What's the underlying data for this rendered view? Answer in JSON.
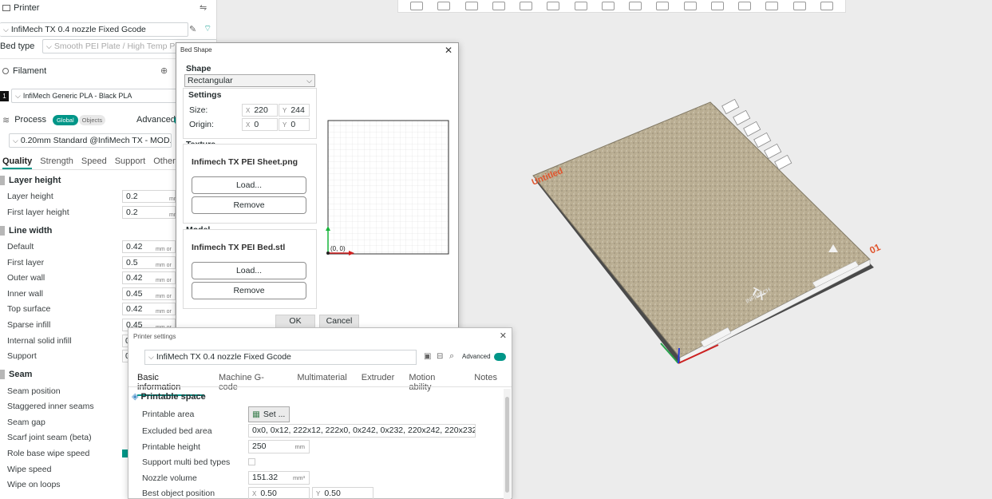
{
  "left": {
    "printer_header": "Printer",
    "printer_name": "InfiMech TX 0.4 nozzle Fixed Gcode",
    "bed_type_label": "Bed type",
    "bed_type_value": "Smooth PEI Plate / High Temp Pla",
    "filament_header": "Filament",
    "filament_index": "1",
    "filament_value": "InfiMech Generic PLA - Black PLA",
    "process_header": "Process",
    "global_badge": "Global",
    "objects_badge": "Objects",
    "advanced_label": "Advanced",
    "process_value": "0.20mm Standard @InfiMech TX - MOD...",
    "tabs": [
      "Quality",
      "Strength",
      "Speed",
      "Support",
      "Others"
    ],
    "groups": {
      "layer_height": "Layer height",
      "line_width": "Line width",
      "seam": "Seam"
    },
    "rows": [
      {
        "label": "Layer height",
        "value": "0.2",
        "unit": "mm"
      },
      {
        "label": "First layer height",
        "value": "0.2",
        "unit": "mm"
      },
      {
        "label": "Default",
        "value": "0.42",
        "unit": "mm or %"
      },
      {
        "label": "First layer",
        "value": "0.5",
        "unit": "mm or %"
      },
      {
        "label": "Outer wall",
        "value": "0.42",
        "unit": "mm or %"
      },
      {
        "label": "Inner wall",
        "value": "0.45",
        "unit": "mm or %"
      },
      {
        "label": "Top surface",
        "value": "0.42",
        "unit": "mm or %"
      },
      {
        "label": "Sparse infill",
        "value": "0.45",
        "unit": "mm or %"
      },
      {
        "label": "Internal solid infill",
        "value": "0",
        "unit": ""
      },
      {
        "label": "Support",
        "value": "0",
        "unit": ""
      }
    ],
    "seam_rows": [
      "Seam position",
      "Staggered inner seams",
      "Seam gap",
      "Scarf joint seam (beta)",
      "Role base wipe speed",
      "Wipe speed",
      "Wipe on loops"
    ]
  },
  "plate": {
    "name": "Untitled",
    "number": "01",
    "brand": "TX",
    "sub": "INFIMECH"
  },
  "bed_dialog": {
    "title": "Bed Shape",
    "shape_header": "Shape",
    "shape_value": "Rectangular",
    "settings_header": "Settings",
    "size_label": "Size:",
    "origin_label": "Origin:",
    "size_x": "220",
    "size_y": "244",
    "origin_x": "0",
    "origin_y": "0",
    "x_tag": "X",
    "y_tag": "Y",
    "texture_header": "Texture",
    "texture_file": "Infimech TX PEI Sheet.png",
    "model_header": "Model",
    "model_file": "Infimech TX PEI Bed.stl",
    "load_label": "Load...",
    "remove_label": "Remove",
    "origin_mark": "(0, 0)",
    "ok_label": "OK",
    "cancel_label": "Cancel"
  },
  "printer_settings": {
    "title": "Printer settings",
    "preset": "InfiMech TX 0.4 nozzle Fixed Gcode",
    "advanced_label": "Advanced",
    "tabs": [
      "Basic information",
      "Machine G-code",
      "Multimaterial",
      "Extruder",
      "Motion ability",
      "Notes"
    ],
    "section": "Printable space",
    "printable_area_label": "Printable area",
    "set_label": "Set ...",
    "excluded_label": "Excluded bed area",
    "excluded_value": "0x0, 0x12, 222x12, 222x0, 0x242, 0x232, 220x242, 220x232",
    "height_label": "Printable height",
    "height_value": "250",
    "height_unit": "mm",
    "multi_bed_label": "Support multi bed types",
    "nozzle_volume_label": "Nozzle volume",
    "nozzle_volume_value": "151.32",
    "nozzle_volume_unit": "mm³",
    "best_pos_label": "Best object position",
    "best_x": "0.50",
    "best_y": "0.50"
  }
}
